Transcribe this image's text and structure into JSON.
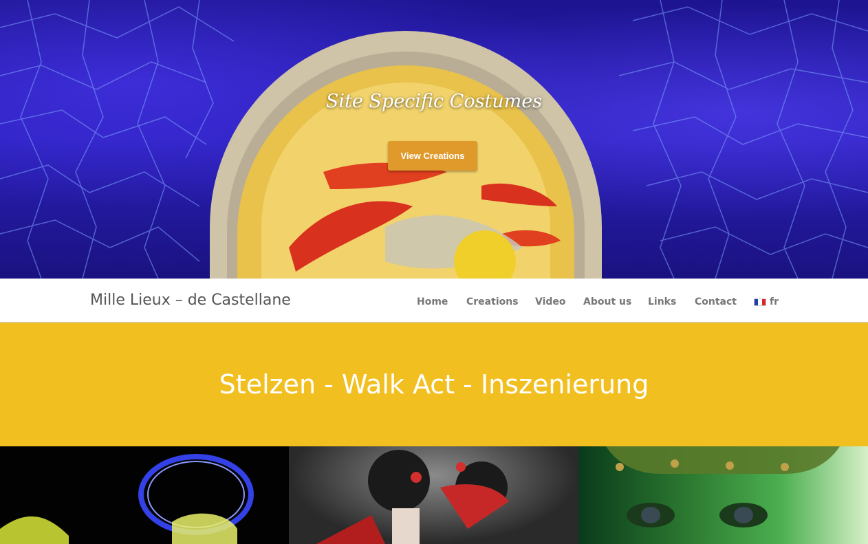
{
  "hero": {
    "title": "Site Specific Costumes",
    "button_label": "View Creations"
  },
  "header": {
    "site_title": "Mille Lieux – de Castellane"
  },
  "nav": {
    "items": [
      {
        "label": "Home"
      },
      {
        "label": "Creations"
      },
      {
        "label": "Video"
      },
      {
        "label": "About us"
      },
      {
        "label": "Links"
      },
      {
        "label": "Contact"
      }
    ],
    "language": {
      "label": "fr",
      "icon": "flag-france-icon"
    }
  },
  "band": {
    "heading": "Stelzen - Walk Act - Inszenierung"
  },
  "colors": {
    "accent_button": "#e09a2c",
    "band_yellow": "#f2bf21",
    "nav_text": "#777777"
  }
}
